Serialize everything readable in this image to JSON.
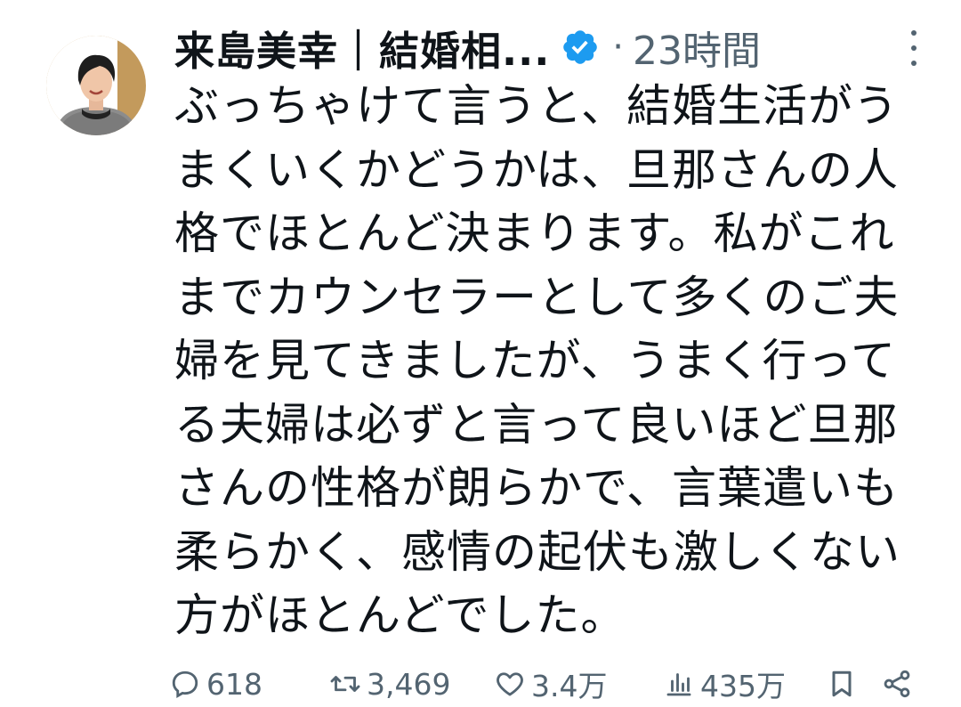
{
  "tweet": {
    "author_name": "来島美幸｜結婚相...",
    "separator": "·",
    "time": "23時間",
    "text": "ぶっちゃけて言うと、結婚生活がう\nまくいくかどうかは、旦那さんの人\n格でほとんど決まります。私がこれ\nまでカウンセラーとして多くのご夫\n婦を見てきましたが、うまく行って\nる夫婦は必ずと言って良いほど旦那\nさんの性格が朗らかで、言葉遣いも\n柔らかく、感情の起伏も激しくない\n方がほとんどでした。"
  },
  "actions": {
    "replies": "618",
    "reposts": "3,469",
    "likes": "3.4万",
    "views": "435万"
  },
  "icons": {
    "verified": "verified-badge-icon",
    "more": "more-options-icon",
    "reply": "reply-icon",
    "repost": "repost-icon",
    "like": "heart-icon",
    "views": "views-icon",
    "bookmark": "bookmark-icon",
    "share": "share-icon"
  },
  "colors": {
    "text": "#0f1419",
    "secondary": "#536471",
    "verified": "#1d9bf0"
  }
}
